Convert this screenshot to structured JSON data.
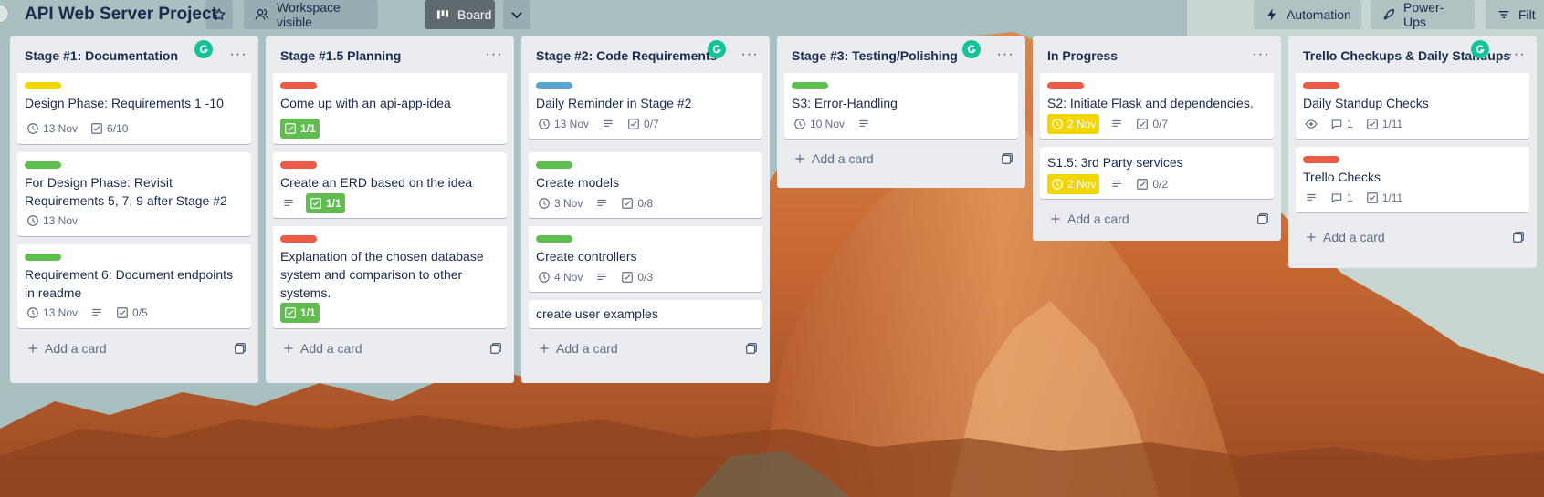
{
  "header": {
    "board_title": "API Web Server Project",
    "visibility_label": "Workspace visible",
    "view_label": "Board",
    "automation_label": "Automation",
    "powerups_label": "Power-Ups",
    "filter_label": "Filt"
  },
  "colors": {
    "yellow_label": "#f2d600",
    "red_label": "#eb5a46",
    "green_label": "#61bd4f",
    "blue_label": "#5ba4cf",
    "grammarly": "#15c39a"
  },
  "add_card_label": "Add a card",
  "lists": [
    {
      "title": "Stage #1: Documentation",
      "cards": [
        {
          "label": "yellow",
          "title": "Design Phase: Requirements 1 -10",
          "due": "13 Nov",
          "checklist": "6/10"
        },
        {
          "label": "green",
          "title": "For Design Phase: Revisit Requirements 5, 7, 9 after Stage #2",
          "due": "13 Nov"
        },
        {
          "label": "green",
          "title": "Requirement 6: Document endpoints in readme",
          "due": "13 Nov",
          "description": true,
          "checklist": "0/5"
        }
      ]
    },
    {
      "title": "Stage #1.5 Planning",
      "cards": [
        {
          "label": "red",
          "title": "Come up with an api-app-idea",
          "checklist_done": "1/1"
        },
        {
          "label": "red",
          "title": "Create an ERD based on the idea",
          "description": true,
          "checklist_done": "1/1"
        },
        {
          "label": "red",
          "title": "Explanation of the chosen database system and comparison to other systems.",
          "checklist_done": "1/1"
        }
      ]
    },
    {
      "title": "Stage #2: Code Requirements",
      "cards": [
        {
          "label": "blue",
          "title": "Daily Reminder in Stage #2",
          "due": "13 Nov",
          "description": true,
          "checklist": "0/7"
        },
        {
          "label": "green",
          "title": "Create models",
          "due": "3 Nov",
          "description": true,
          "checklist": "0/8"
        },
        {
          "label": "green",
          "title": "Create controllers",
          "due": "4 Nov",
          "description": true,
          "checklist": "0/3"
        },
        {
          "title": "create user examples"
        }
      ]
    },
    {
      "title": "Stage #3: Testing/Polishing",
      "cards": [
        {
          "label": "green",
          "title": "S3: Error-Handling",
          "due": "10 Nov",
          "description": true
        }
      ]
    },
    {
      "title": "In Progress",
      "cards": [
        {
          "label": "red",
          "title": "S2: Initiate Flask and dependencies.",
          "due_warn": "2 Nov",
          "description": true,
          "checklist": "0/7"
        },
        {
          "title": "S1.5: 3rd Party services",
          "due_warn": "2 Nov",
          "description": true,
          "checklist": "0/2"
        }
      ]
    },
    {
      "title": "Trello Checkups & Daily Standups",
      "cards": [
        {
          "label": "red",
          "title": "Daily Standup Checks",
          "watch": true,
          "comments": "1",
          "checklist": "1/11"
        },
        {
          "label": "red",
          "title": "Trello Checks",
          "description": true,
          "comments": "1",
          "checklist": "1/11"
        }
      ]
    }
  ]
}
